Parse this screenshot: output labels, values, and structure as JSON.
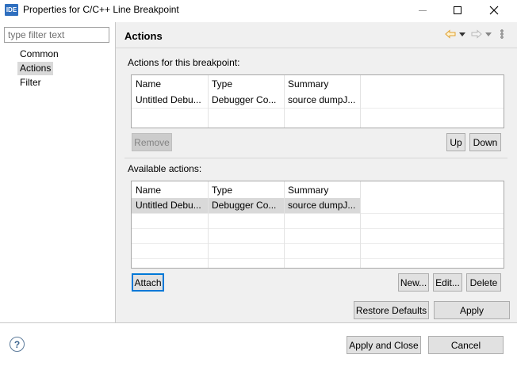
{
  "window": {
    "icon_text": "IDE",
    "title": "Properties for C/C++ Line Breakpoint",
    "minimize_glyph": "—",
    "maximize_glyph": "☐",
    "close_glyph": "✕"
  },
  "sidebar": {
    "filter_placeholder": "type filter text",
    "items": [
      {
        "label": "Common"
      },
      {
        "label": "Actions"
      },
      {
        "label": "Filter"
      }
    ]
  },
  "header": {
    "title": "Actions",
    "icons": [
      "back-arrow-icon",
      "back-menu-icon",
      "forward-arrow-icon",
      "forward-menu-icon",
      "view-menu-icon"
    ]
  },
  "breakpoint_actions": {
    "label": "Actions for this breakpoint:",
    "columns": [
      "Name",
      "Type",
      "Summary"
    ],
    "rows": [
      {
        "name": "Untitled Debu...",
        "type": "Debugger Co...",
        "summary": "source dumpJ..."
      }
    ],
    "remove_label": "Remove",
    "up_label": "Up",
    "down_label": "Down"
  },
  "available_actions": {
    "label": "Available actions:",
    "columns": [
      "Name",
      "Type",
      "Summary"
    ],
    "rows": [
      {
        "name": "Untitled Debu...",
        "type": "Debugger Co...",
        "summary": "source dumpJ..."
      }
    ],
    "attach_label": "Attach",
    "new_label": "New...",
    "edit_label": "Edit...",
    "delete_label": "Delete"
  },
  "page_buttons": {
    "restore_defaults": "Restore Defaults",
    "apply": "Apply"
  },
  "dialog_buttons": {
    "help_glyph": "?",
    "apply_and_close": "Apply and Close",
    "cancel": "Cancel"
  },
  "colors": {
    "accent": "#0078d7",
    "selection": "#d9d9d9",
    "panel_bg": "#f0f0f0",
    "nav_arrow": "#e0a030"
  }
}
